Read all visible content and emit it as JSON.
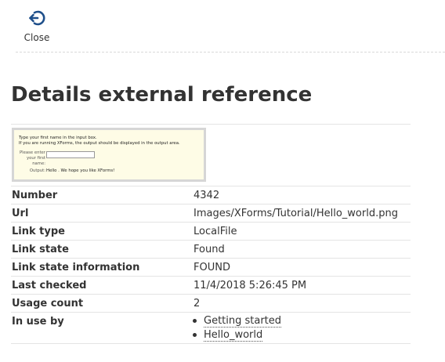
{
  "toolbar": {
    "close_label": "Close",
    "close_icon": "close-icon",
    "accent": "#1e4f8a"
  },
  "page_title": "Details external reference",
  "thumbnail": {
    "line1": "Type your first name in the input box.",
    "line2": "If you are running XForms, the output should be displayed in the output area.",
    "label1": "Please enter",
    "label2": "your first",
    "label3": "name:",
    "output_label": "Output:",
    "output_value": "Hello . We hope you like XForms!"
  },
  "details": [
    {
      "key": "Number",
      "value": "4342"
    },
    {
      "key": "Url",
      "value": "Images/XForms/Tutorial/Hello_world.png"
    },
    {
      "key": "Link type",
      "value": "LocalFile"
    },
    {
      "key": "Link state",
      "value": "Found"
    },
    {
      "key": "Link state information",
      "value": "FOUND"
    },
    {
      "key": "Last checked",
      "value": "11/4/2018 5:26:45 PM"
    },
    {
      "key": "Usage count",
      "value": "2"
    }
  ],
  "in_use_by": {
    "key": "In use by",
    "items": [
      "Getting started",
      "Hello_world"
    ]
  }
}
